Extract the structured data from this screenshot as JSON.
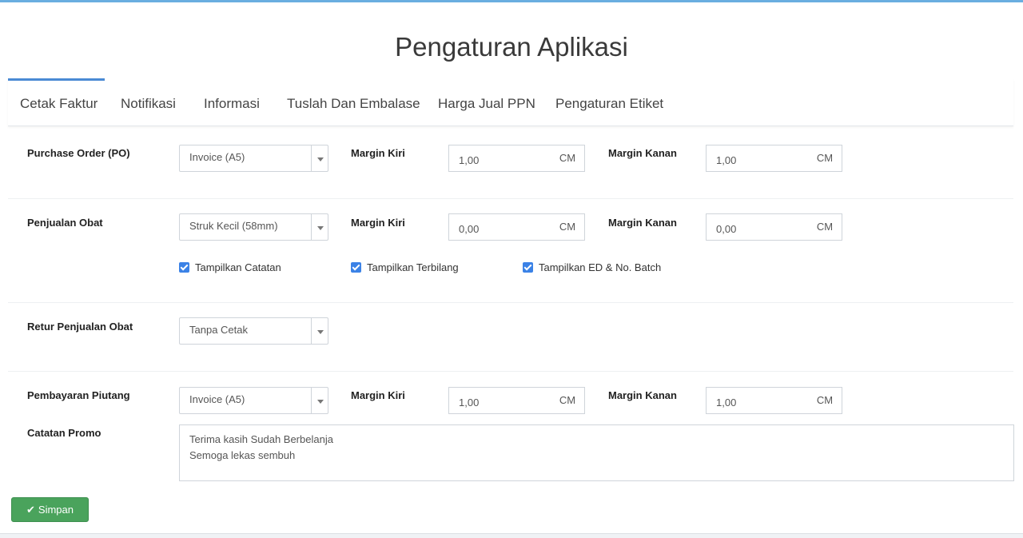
{
  "page": {
    "title": "Pengaturan Aplikasi"
  },
  "tabs": [
    {
      "label": "Cetak Faktur"
    },
    {
      "label": "Notifikasi"
    },
    {
      "label": "Informasi"
    },
    {
      "label": "Tuslah Dan Embalase"
    },
    {
      "label": "Harga Jual PPN"
    },
    {
      "label": "Pengaturan Etiket"
    }
  ],
  "rows": {
    "po": {
      "label": "Purchase Order (PO)",
      "select": "Invoice (A5)",
      "margin_kiri_label": "Margin Kiri",
      "margin_kiri": "1,00",
      "margin_kanan_label": "Margin Kanan",
      "margin_kanan": "1,00",
      "unit": "CM"
    },
    "penjualan": {
      "label": "Penjualan Obat",
      "select": "Struk Kecil (58mm)",
      "margin_kiri_label": "Margin Kiri",
      "margin_kiri": "0,00",
      "margin_kanan_label": "Margin Kanan",
      "margin_kanan": "0,00",
      "unit": "CM",
      "checkboxes": [
        {
          "label": "Tampilkan Catatan",
          "checked": true
        },
        {
          "label": "Tampilkan Terbilang",
          "checked": true
        },
        {
          "label": "Tampilkan ED & No. Batch",
          "checked": true
        }
      ]
    },
    "retur": {
      "label": "Retur Penjualan Obat",
      "select": "Tanpa Cetak"
    },
    "piutang": {
      "label": "Pembayaran Piutang",
      "select": "Invoice (A5)",
      "margin_kiri_label": "Margin Kiri",
      "margin_kiri": "1,00",
      "margin_kanan_label": "Margin Kanan",
      "margin_kanan": "1,00",
      "unit": "CM"
    },
    "promo": {
      "label": "Catatan Promo",
      "line1": "Terima kasih Sudah Berbelanja",
      "line2": "Semoga lekas sembuh"
    }
  },
  "actions": {
    "save_label": "Simpan"
  },
  "colors": {
    "accent": "#4a8ad4",
    "success": "#4aa35c",
    "checkbox": "#3b82e6"
  }
}
